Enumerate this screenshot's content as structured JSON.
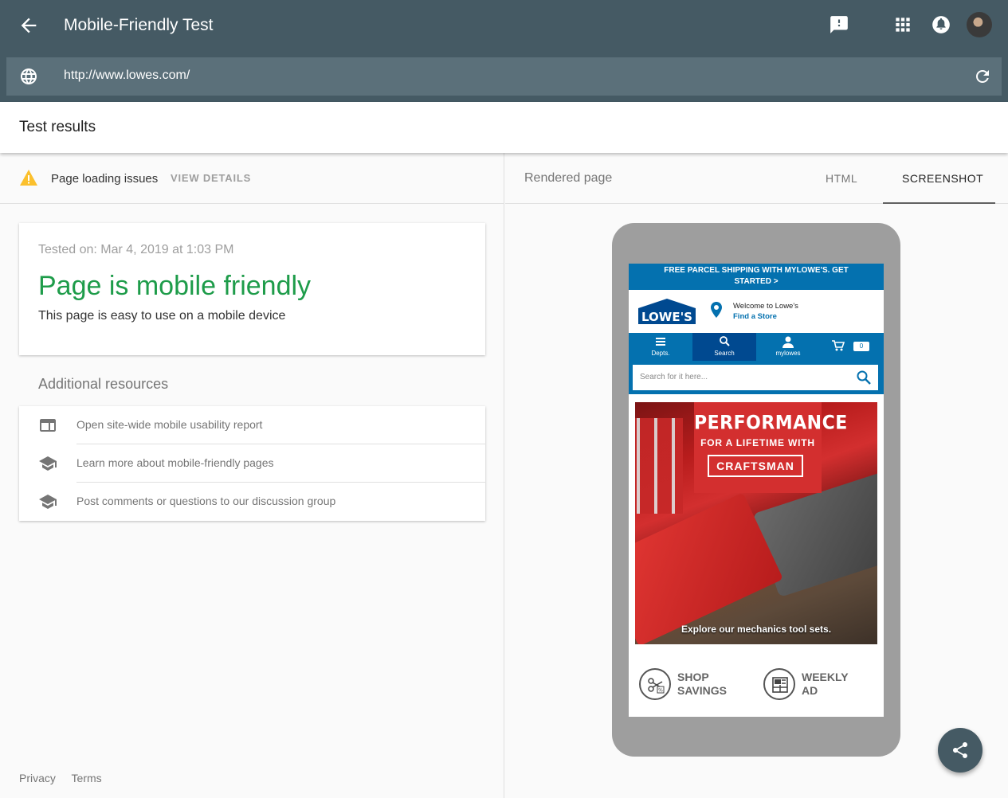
{
  "appbar": {
    "title": "Mobile-Friendly Test",
    "icons": [
      "back-arrow-icon",
      "feedback-icon",
      "apps-grid-icon",
      "notifications-icon"
    ],
    "url": "http://www.lowes.com/"
  },
  "results_header": {
    "title": "Test results"
  },
  "issues": {
    "label": "Page loading issues",
    "view_details": "VIEW DETAILS"
  },
  "result": {
    "tested_on": "Tested on: Mar 4, 2019 at 1:03 PM",
    "verdict": "Page is mobile friendly",
    "description": "This page is easy to use on a mobile device",
    "verdict_color": "#1e9c4a"
  },
  "additional": {
    "title": "Additional resources",
    "items": [
      {
        "label": "Open site-wide mobile usability report",
        "icon": "report-icon"
      },
      {
        "label": "Learn more about mobile-friendly pages",
        "icon": "school-icon"
      },
      {
        "label": "Post comments or questions to our discussion group",
        "icon": "school-icon"
      }
    ]
  },
  "footer": {
    "privacy": "Privacy",
    "terms": "Terms"
  },
  "right": {
    "rendered_page": "Rendered page",
    "tabs": {
      "html": "HTML",
      "screenshot": "SCREENSHOT"
    },
    "active_tab": "SCREENSHOT"
  },
  "preview": {
    "promo": "FREE PARCEL SHIPPING WITH MYLOWE'S. GET STARTED >",
    "logo": "LOWE'S",
    "welcome": "Welcome to Lowe's",
    "find_store": "Find a Store",
    "nav": {
      "depts": "Depts.",
      "search": "Search",
      "mylowes": "mylowes",
      "cart_count": "0"
    },
    "search_placeholder": "Search for it here...",
    "hero": {
      "line1": "PERFORMANCE",
      "line2": "FOR A LIFETIME WITH",
      "brand": "CRAFTSMAN",
      "caption": "Explore our mechanics tool sets."
    },
    "shop_savings": {
      "l1": "SHOP",
      "l2": "SAVINGS"
    },
    "weekly_ad": {
      "l1": "WEEKLY",
      "l2": "AD"
    },
    "brand_blue": "#0471af"
  }
}
